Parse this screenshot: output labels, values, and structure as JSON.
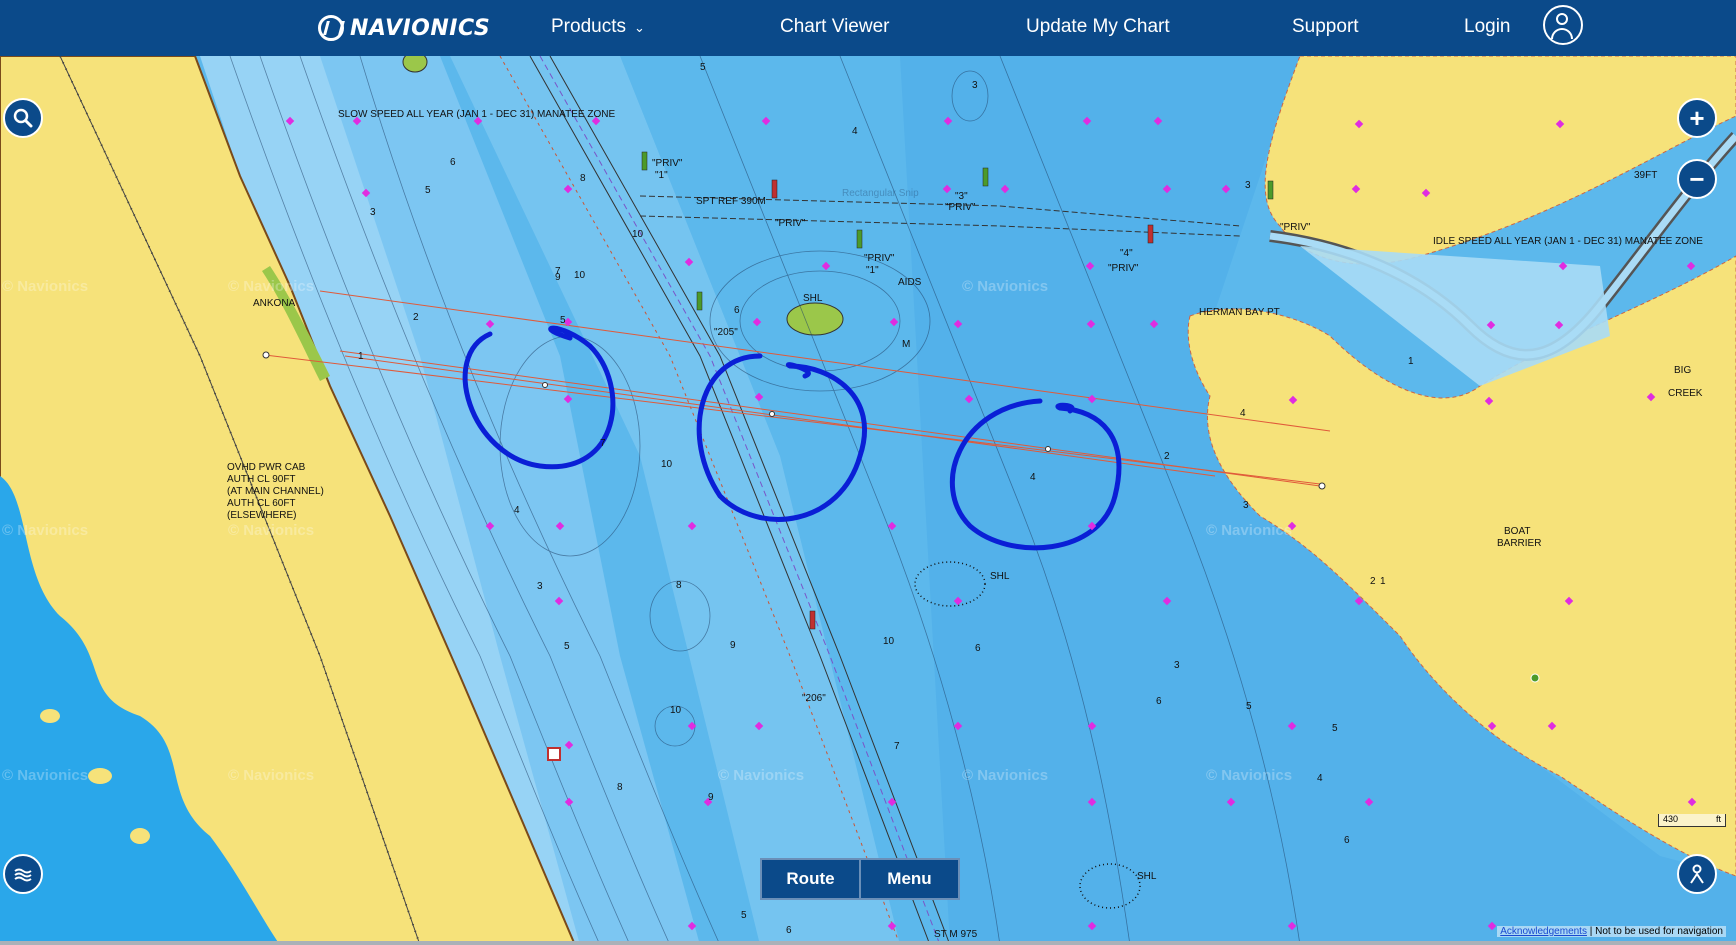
{
  "header": {
    "brand": "NAVIONICS",
    "nav": {
      "products": "Products",
      "chart_viewer": "Chart Viewer",
      "update_my_chart": "Update My Chart",
      "support": "Support",
      "login": "Login"
    }
  },
  "map": {
    "labels": {
      "manatee_zone_slow": "SLOW SPEED ALL YEAR (JAN 1 - DEC 31) MANATEE ZONE",
      "manatee_zone_idle": "IDLE SPEED ALL YEAR (JAN 1 - DEC 31) MANATEE ZONE",
      "ankona": "ANKONA",
      "herman_bay_pt": "HERMAN BAY PT",
      "big_creek_1": "BIG",
      "big_creek_2": "CREEK",
      "boat_barrier_1": "BOAT",
      "boat_barrier_2": "BARRIER",
      "ovhd_1": "OVHD PWR CAB",
      "ovhd_2": "AUTH CL 90FT",
      "ovhd_3": "(AT MAIN CHANNEL)",
      "ovhd_4": "AUTH CL 60FT",
      "ovhd_5": "(ELSEWHERE)",
      "priv_a": "\"PRIV\"",
      "priv_a_num": "\"1\"",
      "priv_b": "\"PRIV\"",
      "priv_c": "\"PRIV\"",
      "priv_d": "\"PRIV\"",
      "priv_d_num": "\"1\"",
      "priv_e": "\"PRIV\"",
      "priv_e_num": "\"4\"",
      "priv_f": "\"PRIV\"",
      "three_a": "\"3\"",
      "aids": "AIDS",
      "shl_1": "SHL",
      "shl_2": "SHL",
      "shl_3": "SHL",
      "m": "M",
      "marker_205": "\"205\"",
      "marker_206": "\"206\"",
      "st_m": "ST M 975",
      "sec_ref": "SPT REF 390M",
      "feet": "39FT",
      "rect_snip": "Rectangular Snip"
    },
    "watermark": "© Navionics",
    "depths": [
      "5",
      "3",
      "4",
      "6",
      "5",
      "3",
      "7",
      "9",
      "10",
      "5",
      "8",
      "10",
      "6",
      "2",
      "1",
      "4",
      "3",
      "5",
      "6",
      "10",
      "8",
      "9",
      "10",
      "7",
      "8",
      "9",
      "10",
      "7",
      "6",
      "5",
      "4",
      "3",
      "2",
      "1",
      "5",
      "6",
      "4",
      "3",
      "2",
      "1",
      "6",
      "5",
      "4",
      "3"
    ],
    "scale": {
      "value": "430",
      "unit": "ft"
    }
  },
  "controls": {
    "route": "Route",
    "menu": "Menu"
  },
  "footer": {
    "acknowledgements": "Acknowledgements",
    "disclaimer": "Not to be used for navigation"
  },
  "colors": {
    "header": "#0b4a8a",
    "land": "#f6e27a",
    "shallow": "#a9dbf6",
    "mid": "#7cc6f2",
    "deep": "#4eaee8",
    "annotation": "#0a1fd6",
    "route_line": "#e05a3a"
  }
}
